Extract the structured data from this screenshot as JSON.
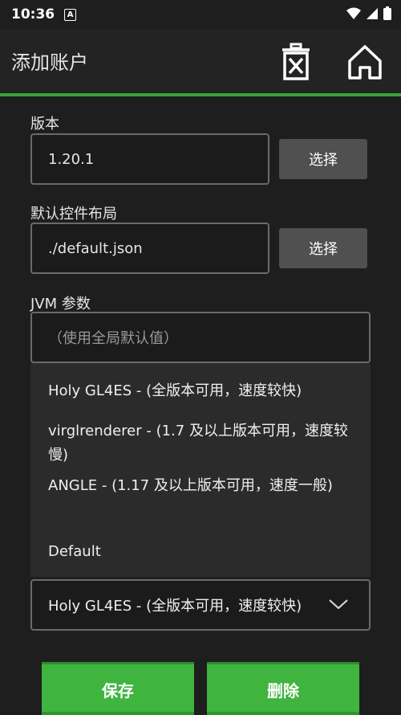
{
  "status": {
    "time": "10:36",
    "a_badge": "A"
  },
  "header": {
    "title": "添加账户",
    "delete_icon": "delete-icon",
    "home_icon": "home-icon"
  },
  "version": {
    "label": "版本",
    "value": "1.20.1",
    "select_label": "选择"
  },
  "controls": {
    "label": "默认控件布局",
    "value": "./default.json",
    "select_label": "选择"
  },
  "jvm": {
    "label": "JVM 参数",
    "placeholder": "（使用全局默认值）"
  },
  "renderer": {
    "options": [
      "Holy GL4ES - (全版本可用，速度较快)",
      "virglrenderer - (1.7 及以上版本可用，速度较慢)",
      "ANGLE - (1.17 及以上版本可用，速度一般)",
      "Default"
    ],
    "selected": "Holy GL4ES - (全版本可用，速度较快)"
  },
  "actions": {
    "save": "保存",
    "remove": "删除"
  },
  "colors": {
    "accent": "#3fb43f",
    "background": "#1e1e1e"
  }
}
